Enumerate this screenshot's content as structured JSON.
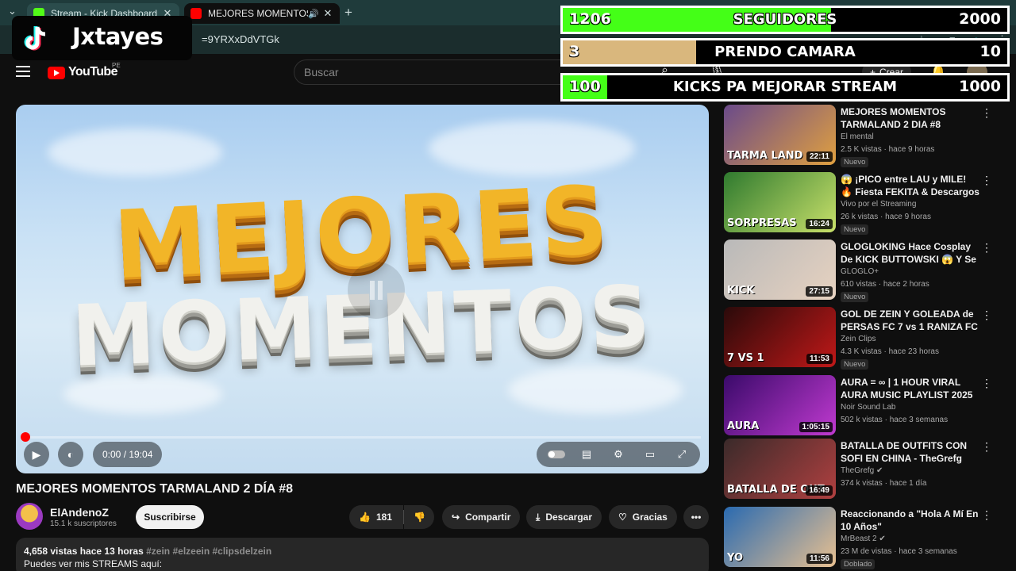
{
  "browser": {
    "tabs": [
      {
        "title": "Stream - Kick Dashboard",
        "active": false,
        "favicon_color": "#53fc18"
      },
      {
        "title": "MEJORES MOMENTOS TARMALAND",
        "active": true,
        "favicon_color": "#ff0000"
      }
    ],
    "url": "=9YRXxDdVTGk"
  },
  "youtube": {
    "logo": "YouTube",
    "country": "PE",
    "search_placeholder": "Buscar",
    "create_label": "Crear"
  },
  "video": {
    "title": "MEJORES MOMENTOS TARMALAND 2 DÍA #8",
    "thumb_line1": "MEJORES",
    "thumb_line2": "MOMENTOS",
    "time": "0:00 / 19:04",
    "progress_fraction": 0.0
  },
  "channel": {
    "name": "ElAndenoZ",
    "subscribers": "15.1 k suscriptores",
    "subscribe_label": "Suscribirse"
  },
  "actions": {
    "likes": "181",
    "share": "Compartir",
    "download": "Descargar",
    "thanks": "Gracias"
  },
  "description": {
    "stats": "4,658 vistas  hace 13 horas",
    "tags": "#zein #elzeein #clipsdelzein",
    "line2": "Puedes ver mis STREAMS aquí:"
  },
  "recommendations": [
    {
      "title": "MEJORES MOMENTOS TARMALAND 2 DIA #8",
      "channel": "El mental",
      "meta": "2.5 K vistas · hace 9 horas",
      "badge": "Nuevo",
      "duration": "22:11",
      "thumb_label": "TARMA LAND",
      "colors": [
        "#6a4a8a",
        "#e0a040"
      ]
    },
    {
      "title": "😱 ¡PICO entre LAU y MILE! 🔥 Fiesta FEKITA & Descargos | ...",
      "channel": "Vivo por el Streaming",
      "meta": "26 k vistas · hace 9 horas",
      "badge": "Nuevo",
      "duration": "16:24",
      "thumb_label": "SORPRESAS",
      "colors": [
        "#2f7a2f",
        "#c8e06a"
      ]
    },
    {
      "title": "GLOGLOKING Hace Cosplay De KICK BUTTOWSKI 😱 Y Se ...",
      "channel": "GLOGLO+",
      "meta": "610 vistas · hace 2 horas",
      "badge": "Nuevo",
      "duration": "27:15",
      "thumb_label": "KICK",
      "colors": [
        "#b9b9b9",
        "#e7d2c0"
      ]
    },
    {
      "title": "GOL DE ZEIN Y GOLEADA de PERSAS FC 7 vs 1 RANIZA FC ...",
      "channel": "Zein Clips",
      "meta": "4.3 K vistas · hace 23 horas",
      "badge": "Nuevo",
      "duration": "11:53",
      "thumb_label": "7 VS 1",
      "colors": [
        "#2a0a0a",
        "#c01818"
      ]
    },
    {
      "title": "AURA = ∞ | 1 HOUR VIRAL AURA MUSIC PLAYLIST 2025 ...",
      "channel": "Noir Sound Lab",
      "meta": "502 k vistas · hace 3 semanas",
      "badge": "",
      "duration": "1:05:15",
      "thumb_label": "AURA",
      "colors": [
        "#3a0a6a",
        "#c03ad0"
      ]
    },
    {
      "title": "BATALLA DE OUTFITS CON SOFI EN CHINA - TheGrefg",
      "channel": "TheGrefg ✔",
      "meta": "374 k vistas · hace 1 día",
      "badge": "",
      "duration": "16:49",
      "thumb_label": "BATALLA DE OUT",
      "colors": [
        "#3a2a2a",
        "#b04040"
      ]
    },
    {
      "title": "Reaccionando a \"Hola A Mí En 10 Años\"",
      "channel": "MrBeast 2 ✔",
      "meta": "23 M de vistas · hace 3 semanas",
      "badge": "Doblado",
      "duration": "11:56",
      "thumb_label": "YO",
      "colors": [
        "#2a6ab0",
        "#e8c090"
      ]
    }
  ],
  "overlay": {
    "streamer": "Jxtayes",
    "goals": [
      {
        "current": "1206",
        "label": "SEGUIDORES",
        "max": "2000",
        "fraction": 0.603,
        "color": "#44ff17"
      },
      {
        "current": "3",
        "label": "PRENDO CAMARA",
        "max": "10",
        "fraction": 0.3,
        "color": "#d9b77d"
      },
      {
        "current": "100",
        "label": "KICKS PA MEJORAR STREAM",
        "max": "1000",
        "fraction": 0.1,
        "color": "#44ff17"
      }
    ]
  }
}
